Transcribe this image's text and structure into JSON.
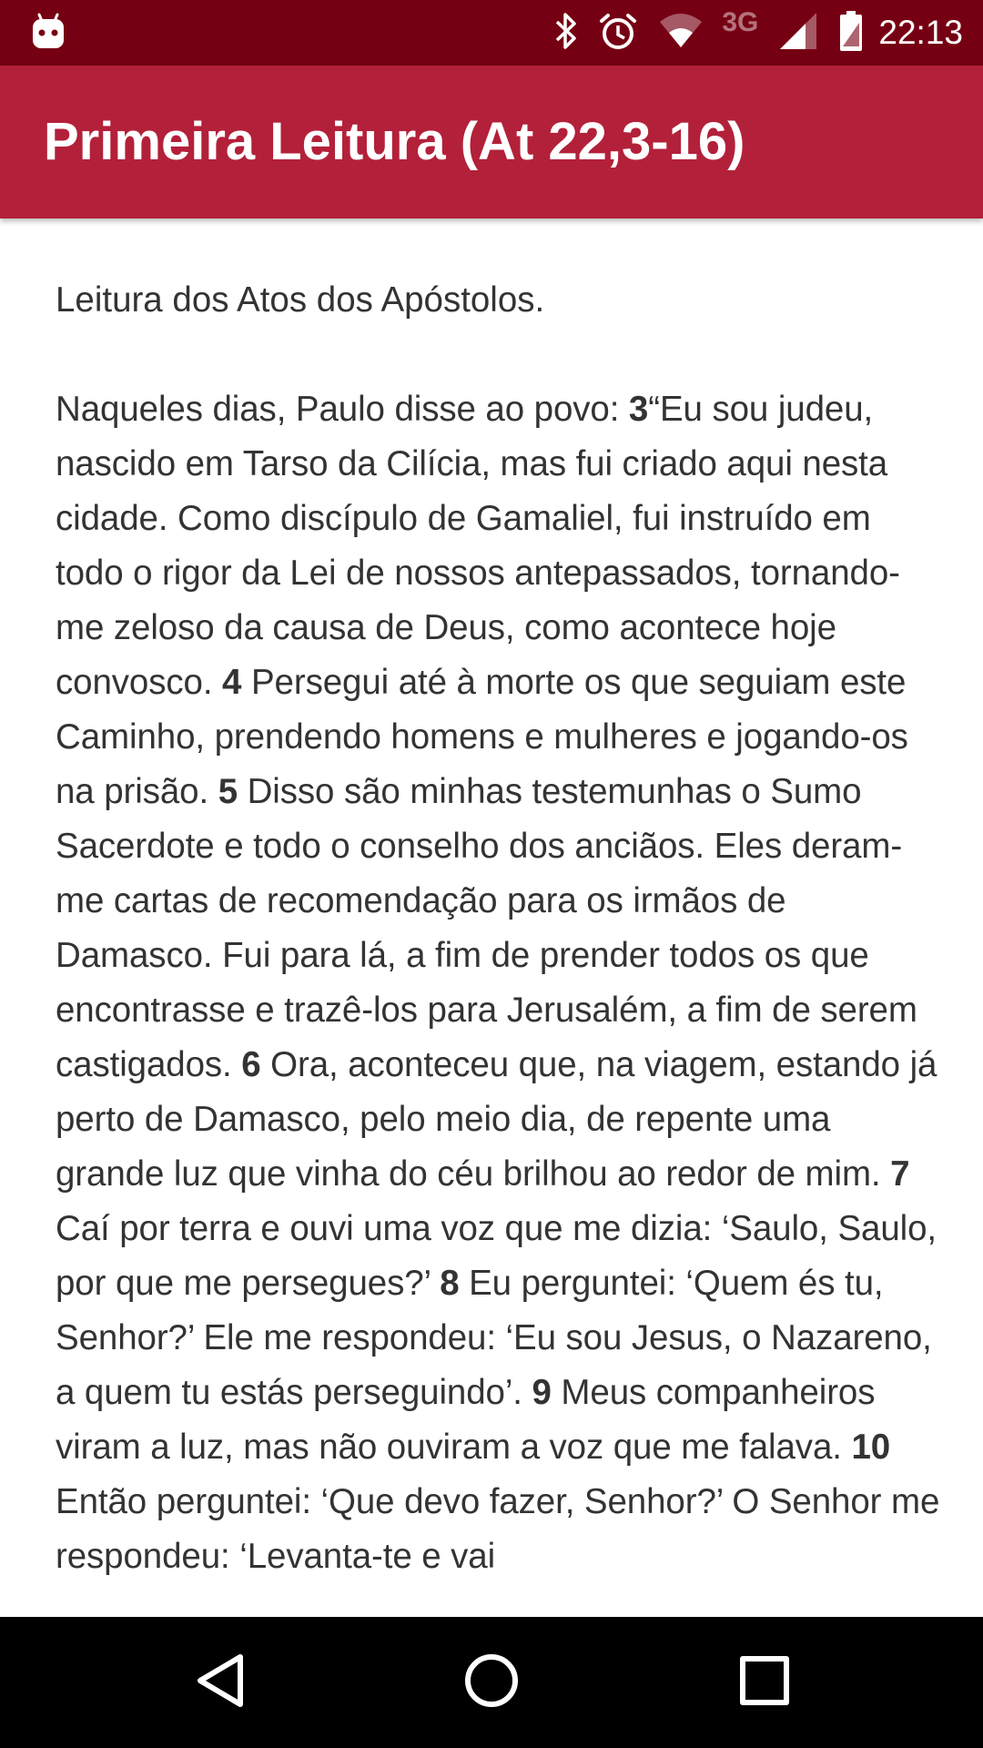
{
  "status_bar": {
    "network": "3G",
    "time": "22:13"
  },
  "app_bar": {
    "title": "Primeira Leitura (At 22,3-16)"
  },
  "reading": {
    "intro": "Leitura dos Atos dos Apóstolos.",
    "segments": [
      {
        "text": "Naqueles dias, Paulo disse ao povo: "
      },
      {
        "verse": "3"
      },
      {
        "text": "“Eu sou judeu, nascido em Tarso da Cilícia, mas fui criado aqui nesta cidade. Como discípulo de Gamaliel, fui instruído em todo o rigor da Lei de nossos antepassados, tornando-me zeloso da causa de Deus, como acontece hoje convosco. "
      },
      {
        "verse": "4"
      },
      {
        "text": "  Persegui até à morte os que seguiam este Caminho, prendendo homens e mulheres e jogando-os na prisão. "
      },
      {
        "verse": "5"
      },
      {
        "text": "  Disso são minhas testemunhas o Sumo Sacerdote e todo o conselho dos anciãos. Eles deram-me cartas de recomendação para os irmãos de Damasco. Fui para lá, a fim de prender todos os que encontrasse e trazê-los para Jerusalém, a fim de serem castigados. "
      },
      {
        "verse": "6"
      },
      {
        "text": "  Ora, aconteceu que, na viagem, estando já perto de Damasco, pelo meio dia, de repente uma grande luz que vinha do céu brilhou ao redor de mim. "
      },
      {
        "verse": "7"
      },
      {
        "text": "  Caí por terra e ouvi uma voz que me dizia: ‘Saulo, Saulo, por que me persegues?’ "
      },
      {
        "verse": "8"
      },
      {
        "text": "  Eu perguntei: ‘Quem és tu, Senhor?’ Ele me respondeu: ‘Eu sou Jesus, o Nazareno, a quem tu estás perseguindo’. "
      },
      {
        "verse": "9"
      },
      {
        "text": "  Meus companheiros viram a luz, mas não ouviram a voz que me falava. "
      },
      {
        "verse": "10"
      },
      {
        "text": "  Então perguntei: ‘Que devo fazer, Senhor?’ O Senhor me respondeu: ‘Levanta-te e vai"
      }
    ]
  },
  "nav_bar": {
    "icons": [
      "back-icon",
      "home-icon",
      "recents-icon"
    ]
  },
  "colors": {
    "status_bar": "#760013",
    "app_bar": "#b3203a",
    "text": "#333333",
    "nav_bar": "#000000"
  }
}
